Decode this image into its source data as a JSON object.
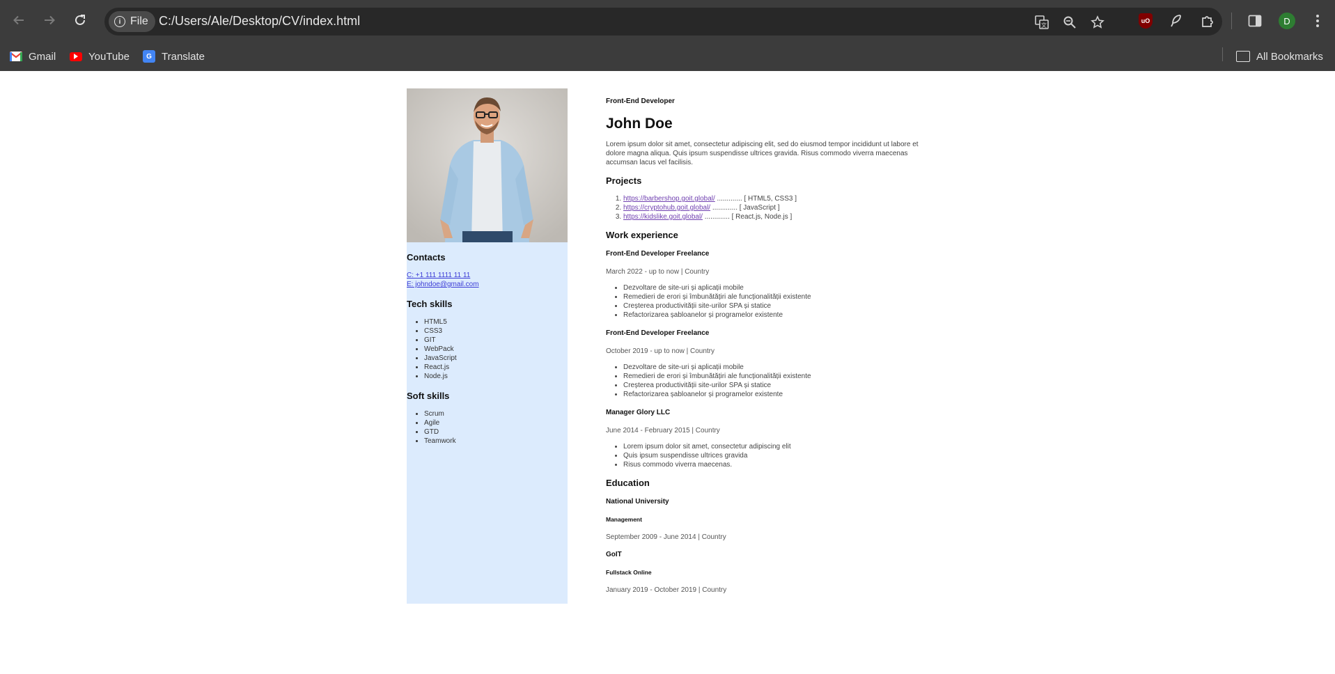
{
  "browser": {
    "file_chip": "File",
    "url": "C:/Users/Ale/Desktop/CV/index.html",
    "avatar_letter": "D",
    "ublock_label": "uO",
    "bookmarks": [
      {
        "label": "Gmail",
        "icon": "gmail-icon"
      },
      {
        "label": "YouTube",
        "icon": "youtube-icon"
      },
      {
        "label": "Translate",
        "icon": "translate-icon"
      }
    ],
    "all_bookmarks": "All Bookmarks"
  },
  "sidebar": {
    "contacts_heading": "Contacts",
    "phone": "C: +1 111 1111 11 11",
    "email": "E: johndoe@gmail.com",
    "tech_heading": "Tech skills",
    "tech_skills": [
      "HTML5",
      "CSS3",
      "GIT",
      "WebPack",
      "JavaScript",
      "React.js",
      "Node.js"
    ],
    "soft_heading": "Soft skills",
    "soft_skills": [
      "Scrum",
      "Agile",
      "GTD",
      "Teamwork"
    ]
  },
  "main": {
    "subtitle": "Front-End Developer",
    "name": "John Doe",
    "intro": "Lorem ipsum dolor sit amet, consectetur adipiscing elit, sed do eiusmod tempor incididunt ut labore et dolore magna aliqua. Quis ipsum suspendisse ultrices gravida. Risus commodo viverra maecenas accumsan lacus vel facilisis.",
    "projects_heading": "Projects",
    "projects": [
      {
        "link": "https://barbershop.goit.global/",
        "tail": " ............. [ HTML5, CSS3 ]"
      },
      {
        "link": "https://cryptohub.goit.global/",
        "tail": " ............. [ JavaScript ]"
      },
      {
        "link": "https://kidslike.goit.global/",
        "tail": " ............. [ React.js, Node.js ]"
      }
    ],
    "work_heading": "Work experience",
    "jobs": [
      {
        "title": "Front-End Developer Freelance",
        "meta": "March 2022 - up to now | Country",
        "items": [
          "Dezvoltare de site-uri și aplicații mobile",
          "Remedieri de erori și îmbunătățiri ale funcționalității existente",
          "Creșterea productivității site-urilor SPA și statice",
          "Refactorizarea șabloanelor și programelor existente"
        ]
      },
      {
        "title": "Front-End Developer Freelance",
        "meta": "October 2019 - up to now | Country",
        "items": [
          "Dezvoltare de site-uri și aplicații mobile",
          "Remedieri de erori și îmbunătățiri ale funcționalității existente",
          "Creșterea productivității site-urilor SPA și statice",
          "Refactorizarea șabloanelor și programelor existente"
        ]
      },
      {
        "title": "Manager Glory LLC",
        "meta": "June 2014 - February 2015 | Country",
        "items": [
          "Lorem ipsum dolor sit amet, consectetur adipiscing elit",
          "Quis ipsum suspendisse ultrices gravida",
          "Risus commodo viverra maecenas."
        ]
      }
    ],
    "education_heading": "Education",
    "education": [
      {
        "school": "National University",
        "program": "Management",
        "meta": "September 2009 - June 2014 | Country"
      },
      {
        "school": "GoIT",
        "program": "Fullstack Online",
        "meta": "January 2019 - October 2019 | Country"
      }
    ]
  }
}
